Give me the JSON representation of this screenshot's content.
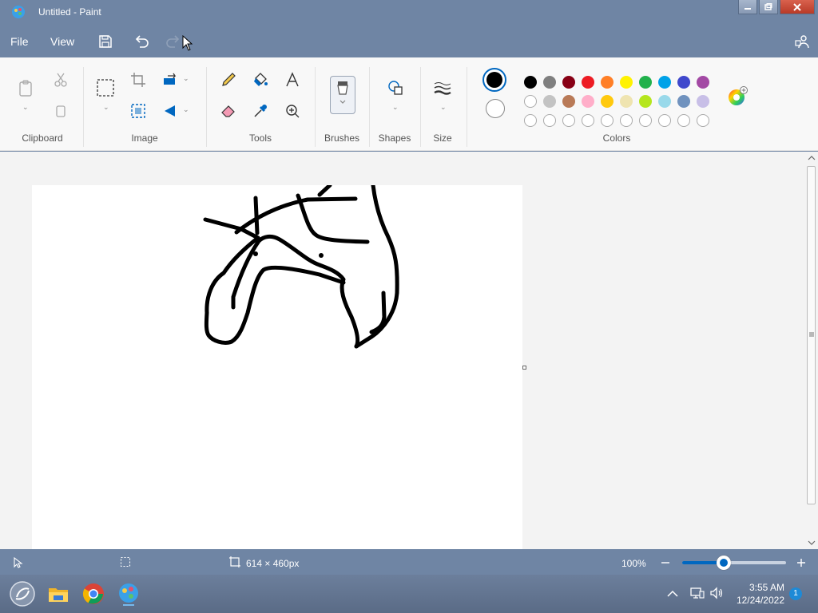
{
  "window": {
    "title": "Untitled - Paint"
  },
  "menu": {
    "file": "File",
    "view": "View"
  },
  "ribbon": {
    "groups": {
      "clipboard": "Clipboard",
      "image": "Image",
      "tools": "Tools",
      "brushes": "Brushes",
      "shapes": "Shapes",
      "size": "Size",
      "colors": "Colors"
    },
    "colors": {
      "primary": "#000000",
      "secondary": "#ffffff",
      "palette_row1": [
        "#000000",
        "#7f7f7f",
        "#880015",
        "#ed1c24",
        "#ff7f27",
        "#fff200",
        "#22b14c",
        "#00a2e8",
        "#3f48cc",
        "#a349a4"
      ],
      "palette_row2": [
        "#ffffff",
        "#c3c3c3",
        "#b97a57",
        "#ffaec9",
        "#ffc90e",
        "#efe4b0",
        "#b5e61d",
        "#99d9ea",
        "#7092be",
        "#c8bfe7"
      ],
      "palette_row3_count_empty": 10
    }
  },
  "status": {
    "canvas_size": "614 × 460px",
    "zoom": "100%",
    "zoom_level": 0.4
  },
  "taskbar": {
    "time": "3:55 AM",
    "date": "12/24/2022",
    "notifications": "1"
  }
}
